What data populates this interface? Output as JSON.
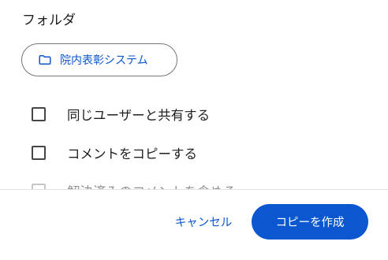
{
  "dialog": {
    "section_label": "フォルダ",
    "folder_chip": {
      "label": "院内表彰システム",
      "icon": "folder-icon"
    },
    "options": [
      {
        "label": "同じユーザーと共有する",
        "checked": false
      },
      {
        "label": "コメントをコピーする",
        "checked": false
      },
      {
        "label": "解決済みのコメントを含める",
        "checked": false,
        "disabled": true
      }
    ],
    "actions": {
      "cancel_label": "キャンセル",
      "confirm_label": "コピーを作成"
    }
  },
  "colors": {
    "accent": "#0b57d0",
    "text": "#1f1f1f",
    "outline": "#747775",
    "checkbox_border": "#444746",
    "disabled": "#c4c7c5",
    "background": "#ffffff"
  }
}
